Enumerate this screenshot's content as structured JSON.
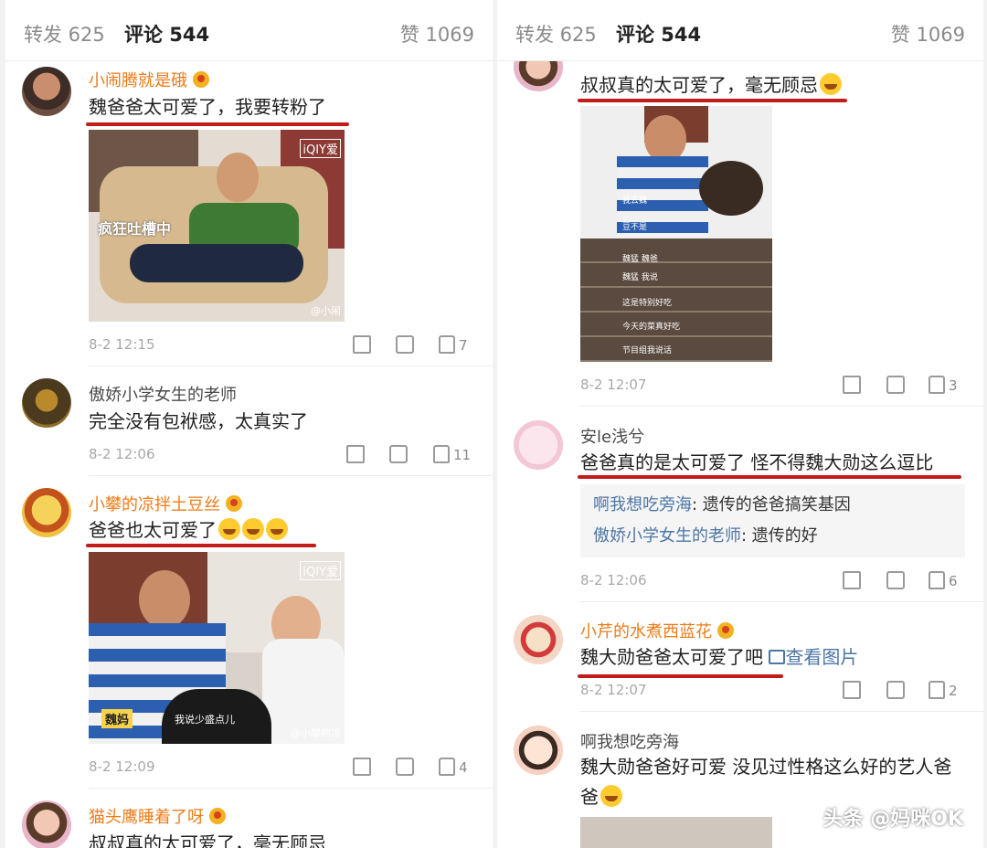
{
  "tabs": {
    "forward": "转发 625",
    "comments": "评论 544",
    "likes": "赞 1069"
  },
  "left": {
    "c1": {
      "user": "小闹腾就是硪",
      "text": "魏爸爸太可爱了，我要转粉了",
      "time": "8-2 12:15",
      "likes": "7",
      "image": {
        "logo": "iQIY爱",
        "caption": "疯狂吐槽中",
        "watermark": "@小闹"
      }
    },
    "c2": {
      "user": "傲娇小学女生的老师",
      "text": "完全没有包袱感，太真实了",
      "time": "8-2 12:06",
      "likes": "11"
    },
    "c3": {
      "user": "小攀的凉拌土豆丝",
      "text": "爸爸也太可爱了",
      "time": "8-2 12:09",
      "likes": "4",
      "image": {
        "logo": "iQIY爱",
        "tag": "魏妈",
        "caption": "我说少盛点儿",
        "watermark": "@小攀的凉"
      }
    },
    "c4": {
      "user": "猫头鹰睡着了呀",
      "text": "叔叔真的太可爱了，毫无顾忌"
    }
  },
  "right": {
    "c1": {
      "text": "叔叔真的太可爱了，毫无顾忌",
      "time": "8-2 12:07",
      "likes": "3",
      "image": {
        "captions": [
          "我去魏",
          "豆不是",
          "魏猛 魏爸",
          "魏猛 我说",
          "这是特别好吃",
          "今天的菜真好吃",
          "节目组我说话"
        ]
      }
    },
    "c2": {
      "user": "安le浅兮",
      "text": "爸爸真的是太可爱了 怪不得魏大勋这么逗比",
      "time": "8-2 12:06",
      "likes": "6",
      "replies": [
        {
          "name": "啊我想吃旁海",
          "text": ": 遗传的爸爸搞笑基因"
        },
        {
          "name": "傲娇小学女生的老师",
          "text": ": 遗传的好"
        }
      ]
    },
    "c3": {
      "user": "小芹的水煮西蓝花",
      "text": "魏大勋爸爸太可爱了吧",
      "link": "查看图片",
      "time": "8-2 12:07",
      "likes": "2"
    },
    "c4": {
      "user": "啊我想吃旁海",
      "text": "魏大勋爸爸好可爱 没见过性格这么好的艺人爸爸"
    }
  },
  "watermark": "头条 @妈咪OK",
  "colors": {
    "vip_name": "#ef7b17",
    "underline": "#c31a1a",
    "link": "#4d76a6"
  }
}
